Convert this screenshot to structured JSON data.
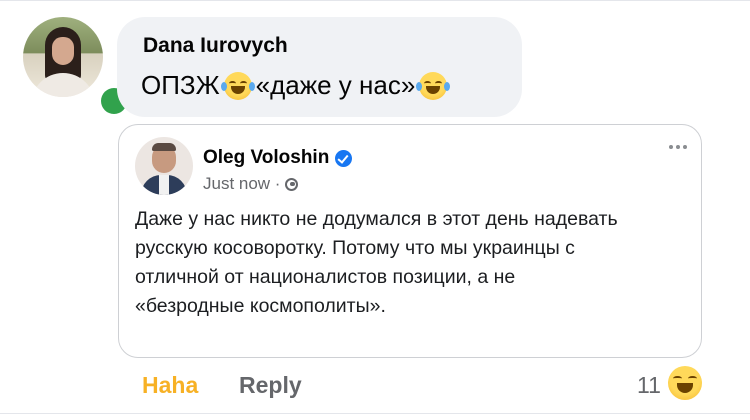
{
  "comment": {
    "author": "Dana Iurovych",
    "text_part1": "ОПЗЖ",
    "text_part2": " «даже у нас»",
    "emoji": "laughing-tears"
  },
  "embedded_post": {
    "author": "Oleg Voloshin",
    "verified": true,
    "timestamp": "Just now ·",
    "audience_icon": "globe-icon",
    "text": "Даже у нас никто не додумался в этот день надевать\nрусскую косоворотку. Потому что мы украинцы с\nотличной от националистов позиции, а не\n«безродные космополиты»."
  },
  "actions": {
    "reaction_label": "Haha",
    "reply_label": "Reply",
    "reaction_count": "11"
  },
  "colors": {
    "bubble_bg": "#f0f2f5",
    "haha_accent": "#f7b125",
    "online_green": "#31a24c",
    "verified_blue": "#1877f2",
    "meta_gray": "#65676b"
  }
}
